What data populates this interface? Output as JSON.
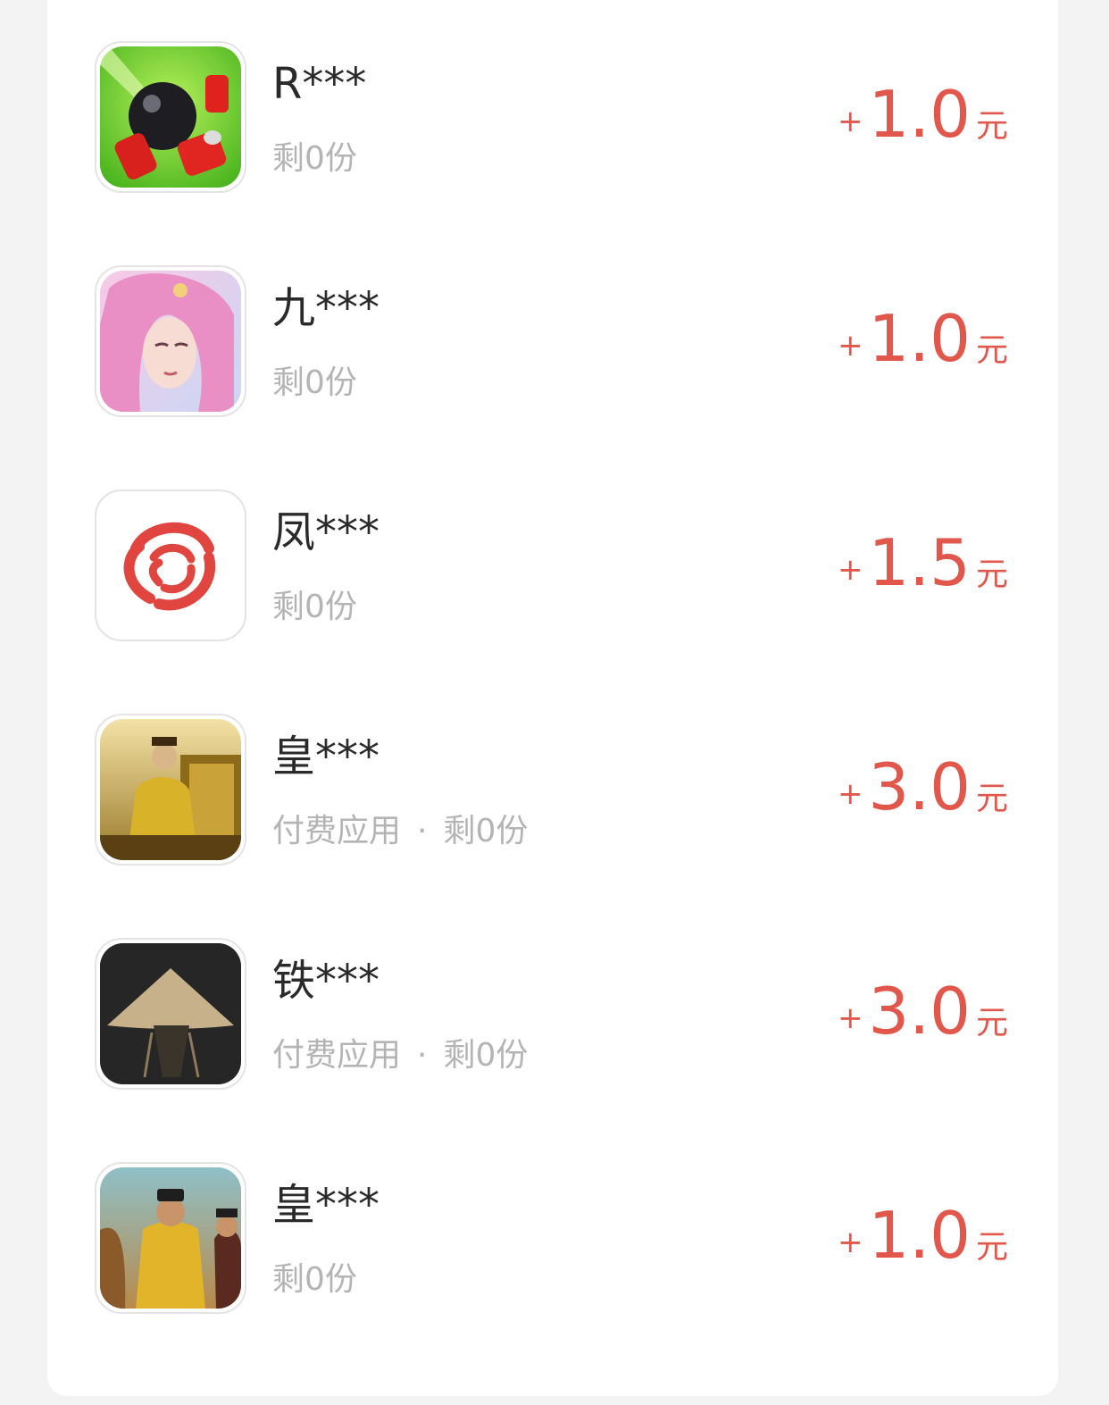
{
  "items": [
    {
      "title": "R***",
      "sub": "",
      "remaining": "剩0份",
      "plus": "+",
      "amount": "1.0",
      "unit": "元",
      "icon": "ball-cans-game-icon"
    },
    {
      "title": "九***",
      "sub": "",
      "remaining": "剩0份",
      "plus": "+",
      "amount": "1.0",
      "unit": "元",
      "icon": "fantasy-woman-game-icon"
    },
    {
      "title": "凤***",
      "sub": "",
      "remaining": "剩0份",
      "plus": "+",
      "amount": "1.5",
      "unit": "元",
      "icon": "phoenix-logo-icon"
    },
    {
      "title": "皇***",
      "sub": "付费应用",
      "dot": "·",
      "remaining": "剩0份",
      "plus": "+",
      "amount": "3.0",
      "unit": "元",
      "icon": "emperor-throne-game-icon"
    },
    {
      "title": "铁***",
      "sub": "付费应用",
      "dot": "·",
      "remaining": "剩0份",
      "plus": "+",
      "amount": "3.0",
      "unit": "元",
      "icon": "straw-hat-warrior-game-icon"
    },
    {
      "title": "皇***",
      "sub": "",
      "remaining": "剩0份",
      "plus": "+",
      "amount": "1.0",
      "unit": "元",
      "icon": "emperor-court-game-icon"
    }
  ]
}
